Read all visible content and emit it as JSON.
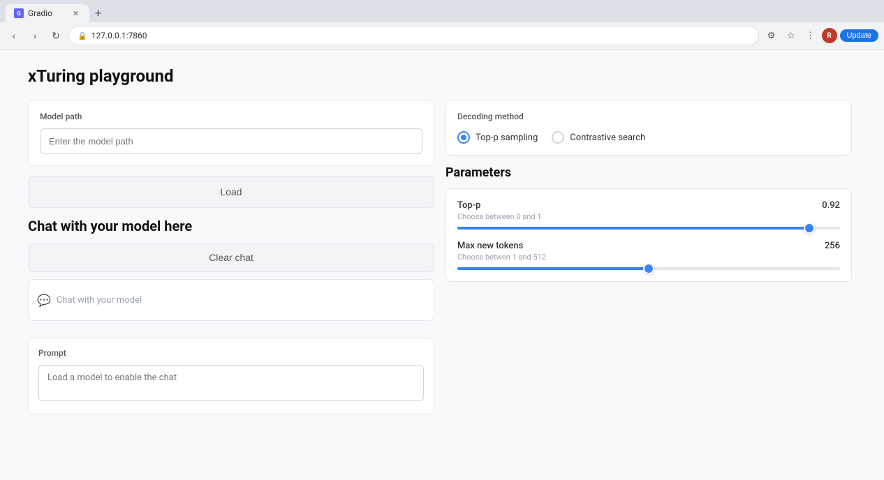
{
  "browser": {
    "tab_title": "Gradio",
    "tab_favicon": "G",
    "new_tab_symbol": "+",
    "url": "127.0.0.1:7860",
    "update_button": "Update"
  },
  "page": {
    "title": "xTuring playground",
    "model_path": {
      "label": "Model path",
      "placeholder": "Enter the model path"
    },
    "load_button": "Load",
    "chat_section": {
      "title": "Chat with your model here",
      "clear_button": "Clear chat",
      "placeholder": "Chat with your model"
    },
    "prompt": {
      "label": "Prompt",
      "placeholder": "Load a model to enable the chat"
    }
  },
  "right_panel": {
    "decoding": {
      "label": "Decoding method",
      "options": [
        "Top-p sampling",
        "Contrastive search"
      ],
      "selected": "Top-p sampling"
    },
    "parameters": {
      "title": "Parameters",
      "top_p": {
        "name": "Top-p",
        "hint": "Choose between 0 and 1",
        "value": "0.92",
        "fill_percent": 92
      },
      "max_tokens": {
        "name": "Max new tokens",
        "hint": "Choose betwen 1 and 512",
        "value": "256",
        "fill_percent": 50
      }
    }
  }
}
